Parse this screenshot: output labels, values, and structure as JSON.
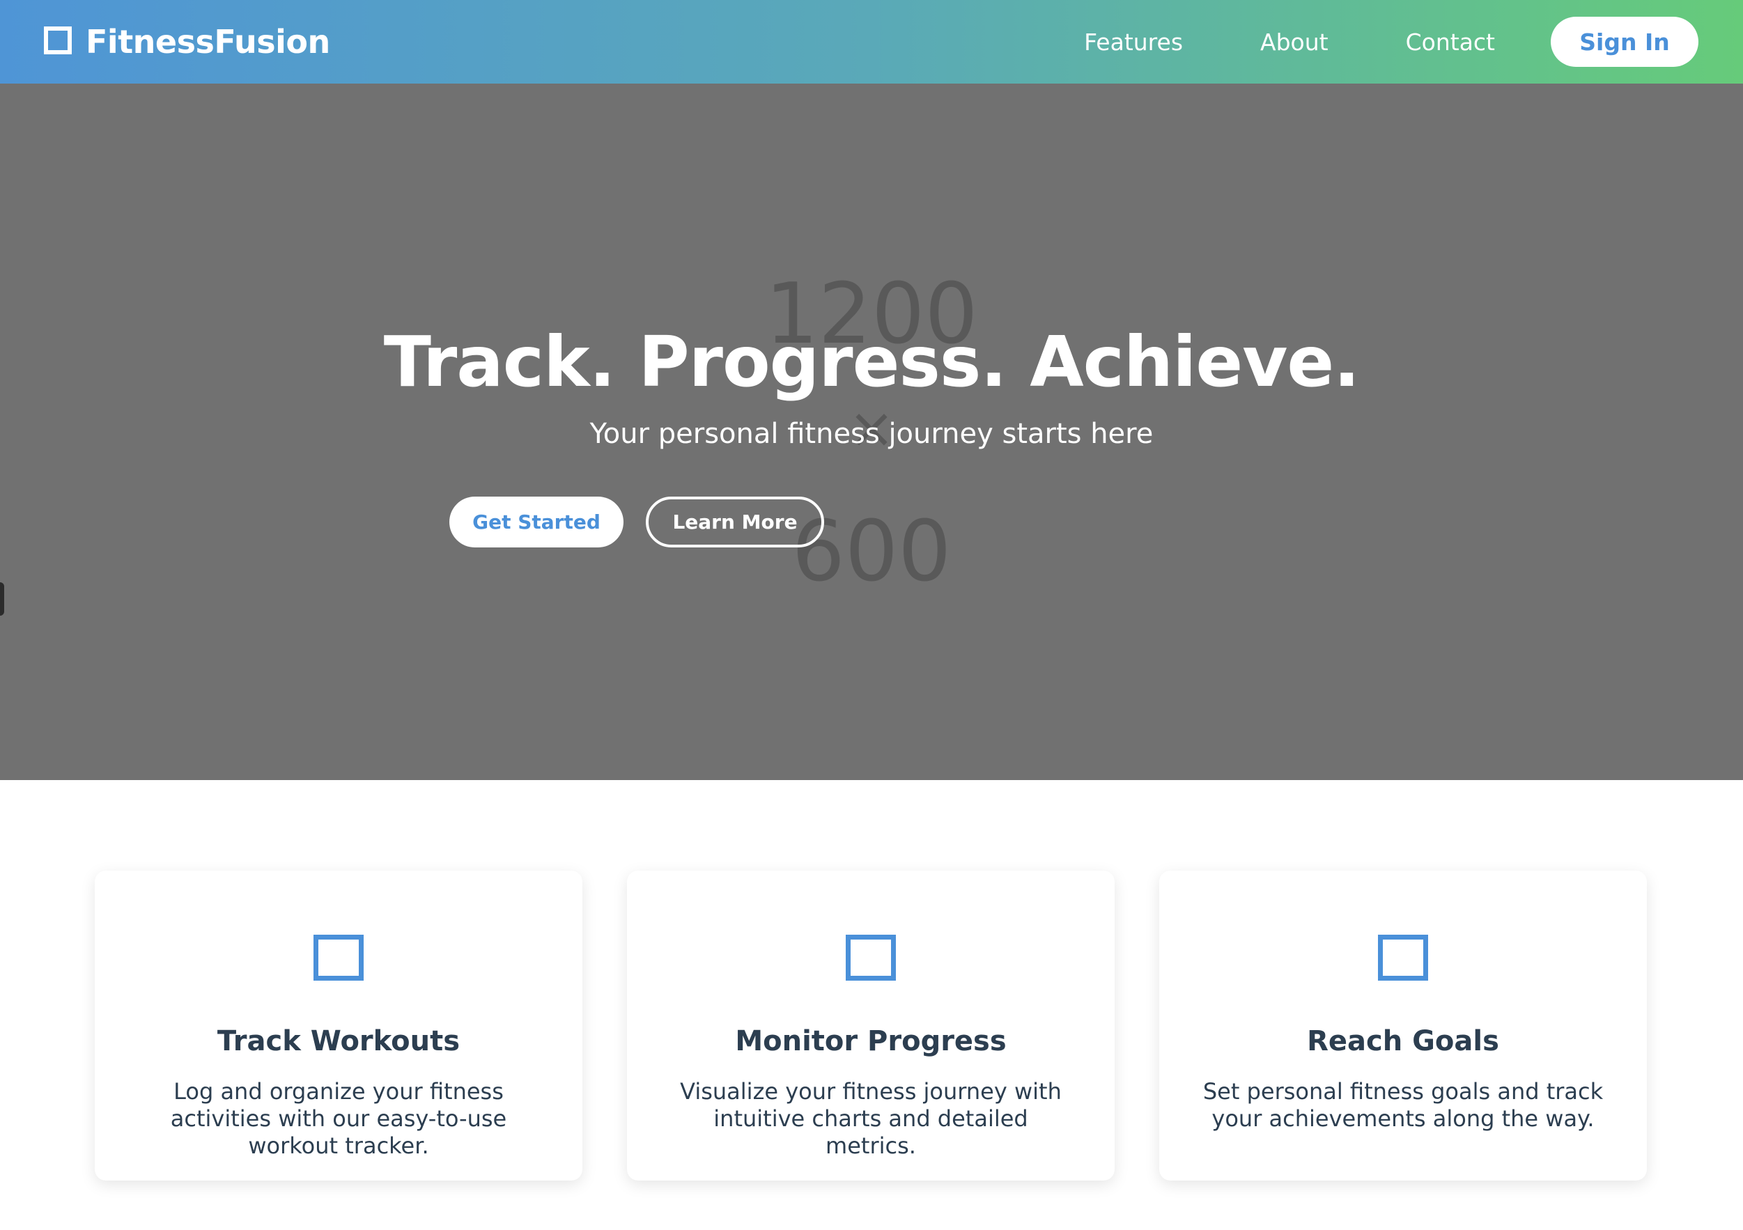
{
  "navbar": {
    "brand_name": "FitnessFusion",
    "brand_icon": "square-outline-icon",
    "links": [
      "Features",
      "About",
      "Contact"
    ],
    "signin_label": "Sign In"
  },
  "hero": {
    "placeholder": {
      "width_text": "1200",
      "times_text": "×",
      "height_text": "600"
    },
    "title": "Track. Progress. Achieve.",
    "subtitle": "Your personal fitness journey starts here",
    "primary_cta": "Get Started",
    "secondary_cta": "Learn More"
  },
  "features": [
    {
      "icon": "square-outline-icon",
      "title": "Track Workouts",
      "description": "Log and organize your fitness activities with our easy-to-use workout tracker."
    },
    {
      "icon": "square-outline-icon",
      "title": "Monitor Progress",
      "description": "Visualize your fitness journey with intuitive charts and detailed metrics."
    },
    {
      "icon": "square-outline-icon",
      "title": "Reach Goals",
      "description": "Set personal fitness goals and track your achievements along the way."
    }
  ],
  "colors": {
    "accent": "#4a90d9",
    "gradient_start": "#4f95d6",
    "gradient_end": "#66cb7a",
    "hero_bg": "#717171",
    "text_dark": "#2c3e50"
  }
}
